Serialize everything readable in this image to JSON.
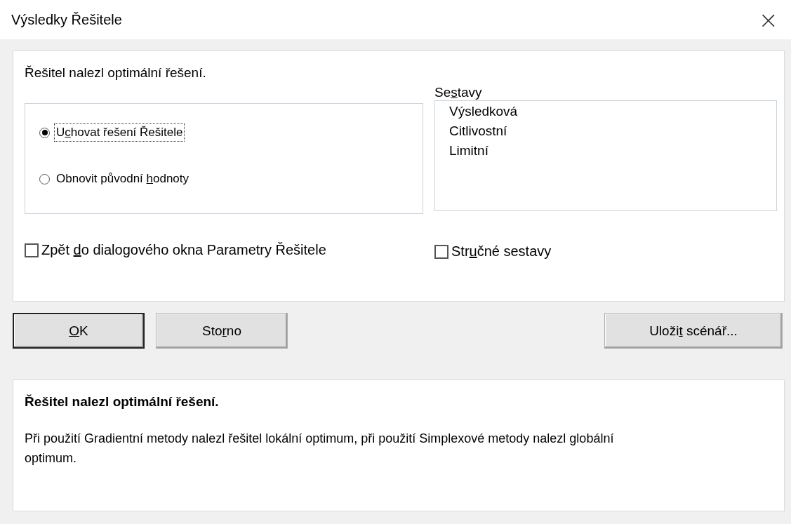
{
  "window": {
    "title": "Výsledky Řešitele",
    "close": "×"
  },
  "message": "Řešitel nalezl optimální řešení.",
  "options": [
    {
      "label": {
        "before": "U",
        "access_key": "c",
        "after": "hovat řešení Řešitele"
      },
      "selected": true,
      "focused": true
    },
    {
      "label": {
        "before": "Obnovit původní ",
        "access_key": "h",
        "after": "odnoty"
      },
      "selected": false,
      "focused": false
    }
  ],
  "reports": {
    "label": {
      "before": "Se",
      "access_key": "s",
      "after": "tavy"
    },
    "items": [
      {
        "label": "Výsledková",
        "selected": false
      },
      {
        "label": "Citlivostní",
        "selected": false
      },
      {
        "label": "Limitní",
        "selected": false
      }
    ]
  },
  "return_checkbox": {
    "label": {
      "before": "Zpět ",
      "access_key": "d",
      "after": "o dialogového okna Parametry Řešitele"
    },
    "checked": false
  },
  "outline_checkbox": {
    "label": {
      "before": "Str",
      "access_key": "u",
      "after": "čné sestavy"
    },
    "checked": false
  },
  "buttons": [
    {
      "label": {
        "access_key": "O",
        "after": "K"
      },
      "default": true
    },
    {
      "label": {
        "before": "Sto",
        "access_key": "r",
        "after": "no"
      },
      "default": false
    },
    {
      "label": {
        "before": "Uloži",
        "access_key": "t",
        "after": " scénář..."
      },
      "default": false
    }
  ],
  "info": {
    "heading": "Řešitel nalezl optimální řešení.",
    "text": "Při použití Gradientní metody nalezl řešitel lokální optimum, při použití Simplexové metody nalezl globální optimum."
  }
}
